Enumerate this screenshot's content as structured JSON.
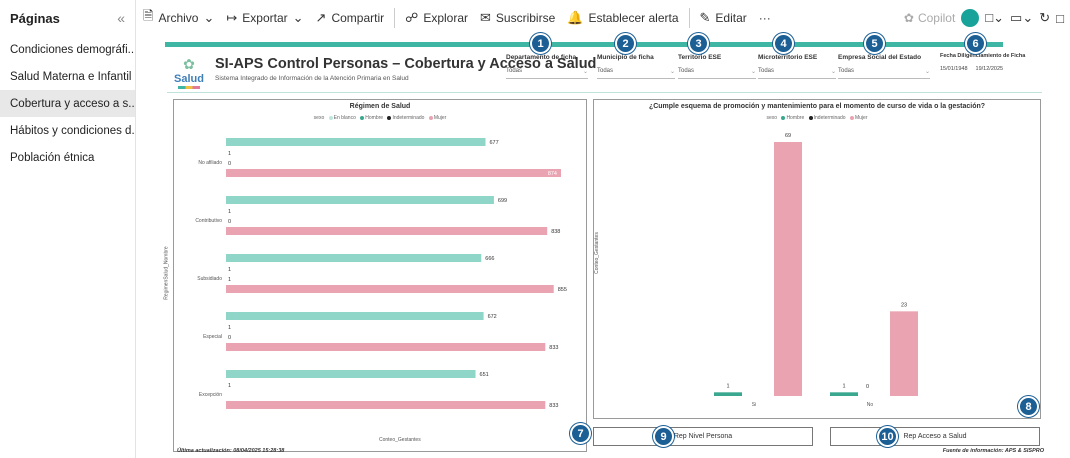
{
  "pages": {
    "title": "Páginas",
    "collapse_icon": "«",
    "items": [
      {
        "label": "Condiciones demográfi..."
      },
      {
        "label": "Salud Materna e Infantil"
      },
      {
        "label": "Cobertura y acceso a s..."
      },
      {
        "label": "Hábitos y condiciones d..."
      },
      {
        "label": "Población étnica"
      }
    ],
    "active_index": 2
  },
  "toolbar": {
    "file": "Archivo",
    "export": "Exportar",
    "share": "Compartir",
    "explore": "Explorar",
    "subscribe": "Suscribirse",
    "alert": "Establecer alerta",
    "edit": "Editar",
    "more": "···",
    "copilot": "Copilot"
  },
  "report": {
    "logo_text": "Salud",
    "title": "SI-APS Control Personas – Cobertura y Acceso a Salud",
    "subtitle": "Sistema Integrado de Información de la Atención Primaria en Salud",
    "filters": [
      {
        "label": "Departamento de ficha",
        "value": "Todas"
      },
      {
        "label": "Municipio de ficha",
        "value": "Todas"
      },
      {
        "label": "Territorio ESE",
        "value": "Todas"
      },
      {
        "label": "Microterritorio ESE",
        "value": "Todas"
      },
      {
        "label": "Empresa Social del Estado",
        "value": "Todas"
      }
    ],
    "date_filter": {
      "label": "Fecha Diligenciamiento de Ficha",
      "from": "15/01/1948",
      "to": "19/12/2025"
    },
    "badges": [
      "1",
      "2",
      "3",
      "4",
      "5",
      "6",
      "7",
      "8",
      "9",
      "10"
    ],
    "buttons": {
      "nivel_persona": "Rep Nivel Persona",
      "acceso_salud": "Rep Acceso a Salud"
    },
    "last_update": "Última actualización: 08/04/2025 15:28:38",
    "source": "Fuente de información: APS & SISPRO"
  },
  "colors": {
    "teal": "#8fd5c8",
    "pink": "#e9a3b1",
    "hombre": "#3aa78f",
    "accent": "#3fb5a4",
    "badge": "#1b5f95"
  },
  "chart_data": [
    {
      "type": "bar",
      "orientation": "horizontal",
      "title": "Régimen de Salud",
      "legend_title": "sexo",
      "legend": [
        "En blanco",
        "Hombre",
        "Indeterminado",
        "Mujer"
      ],
      "ylabel": "RegimenSalud_Nombre",
      "xlabel": "Conteo_Gestantes",
      "categories": [
        "No afiliado",
        "Contributivo",
        "Subsidiado",
        "Especial",
        "Excepción"
      ],
      "series": [
        {
          "name": "Hombre",
          "values": [
            677,
            699,
            666,
            672,
            651
          ]
        },
        {
          "name": "Indeterminado",
          "values": [
            1,
            1,
            1,
            1,
            1
          ]
        },
        {
          "name": "En blanco",
          "values": [
            0,
            0,
            1,
            0,
            null
          ]
        },
        {
          "name": "Mujer",
          "values": [
            874,
            838,
            855,
            833,
            833
          ]
        }
      ]
    },
    {
      "type": "bar",
      "title": "¿Cumple esquema de promoción y mantenimiento para el momento de curso de vida o la gestación?",
      "legend_title": "sexo",
      "legend": [
        "Hombre",
        "Indeterminado",
        "Mujer"
      ],
      "ylabel": "Conteo_Gestantes",
      "categories": [
        "Si",
        "No"
      ],
      "series": [
        {
          "name": "Hombre",
          "values": [
            1,
            1
          ]
        },
        {
          "name": "Indeterminado",
          "values": [
            null,
            0
          ]
        },
        {
          "name": "Mujer",
          "values": [
            69,
            23
          ]
        }
      ]
    }
  ]
}
